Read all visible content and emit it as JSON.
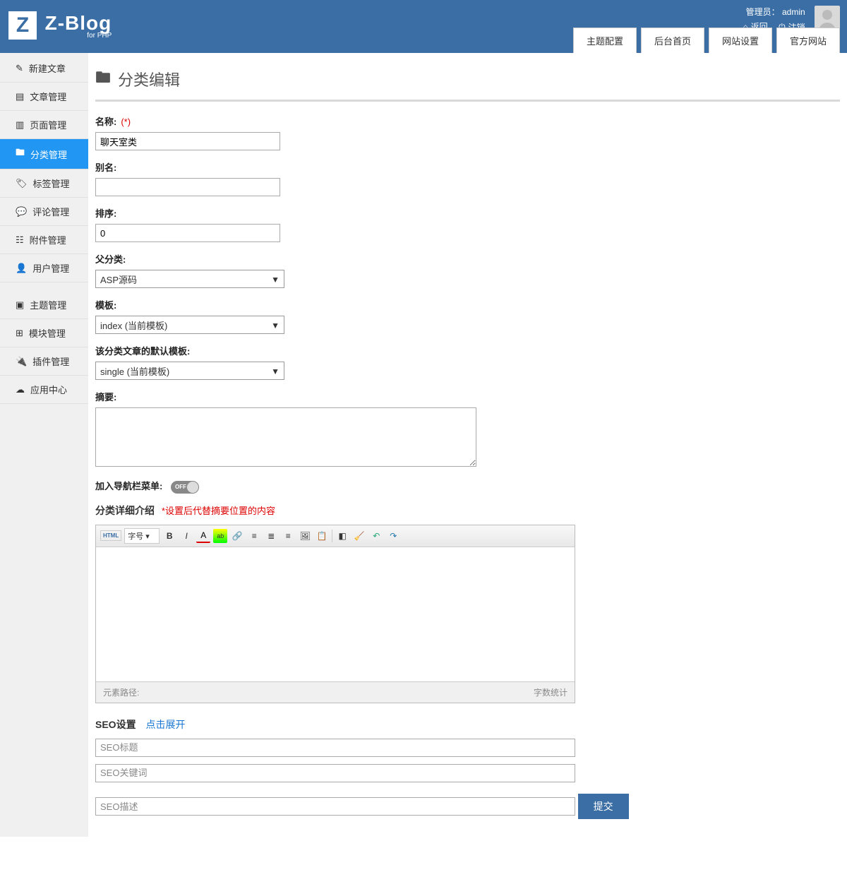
{
  "header": {
    "logo_main": "Z-Blog",
    "logo_sub": "for PHP",
    "admin_label": "管理员：",
    "admin_name": "admin",
    "back_label": "返回",
    "logout_label": "注销"
  },
  "tabs": [
    {
      "label": "主题配置"
    },
    {
      "label": "后台首页"
    },
    {
      "label": "网站设置"
    },
    {
      "label": "官方网站"
    }
  ],
  "sidebar": [
    {
      "label": "新建文章",
      "icon": "edit"
    },
    {
      "label": "文章管理",
      "icon": "file"
    },
    {
      "label": "页面管理",
      "icon": "page"
    },
    {
      "label": "分类管理",
      "icon": "folder",
      "active": true
    },
    {
      "label": "标签管理",
      "icon": "tag"
    },
    {
      "label": "评论管理",
      "icon": "comment"
    },
    {
      "label": "附件管理",
      "icon": "attach"
    },
    {
      "label": "用户管理",
      "icon": "user"
    }
  ],
  "sidebar2": [
    {
      "label": "主题管理",
      "icon": "theme"
    },
    {
      "label": "模块管理",
      "icon": "module"
    },
    {
      "label": "插件管理",
      "icon": "plugin"
    },
    {
      "label": "应用中心",
      "icon": "cloud"
    }
  ],
  "page": {
    "title": "分类编辑",
    "name_label": "名称:",
    "name_required": "(*)",
    "name_value": "聊天室类",
    "alias_label": "别名:",
    "alias_value": "",
    "order_label": "排序:",
    "order_value": "0",
    "parent_label": "父分类:",
    "parent_value": "ASP源码",
    "template_label": "模板:",
    "template_value": "index (当前模板)",
    "default_template_label": "该分类文章的默认模板:",
    "default_template_value": "single (当前模板)",
    "summary_label": "摘要:",
    "summary_value": "",
    "nav_label": "加入导航栏菜单:",
    "nav_state": "OFF",
    "detail_label": "分类详细介绍",
    "detail_hint": "*设置后代替摘要位置的内容",
    "editor": {
      "html_btn": "HTML",
      "fontsize": "字号",
      "path_label": "元素路径:",
      "count_label": "字数统计"
    },
    "seo_label": "SEO设置",
    "seo_expand": "点击展开",
    "seo_title_ph": "SEO标题",
    "seo_keywords_ph": "SEO关键词",
    "seo_desc_ph": "SEO描述",
    "submit": "提交"
  }
}
